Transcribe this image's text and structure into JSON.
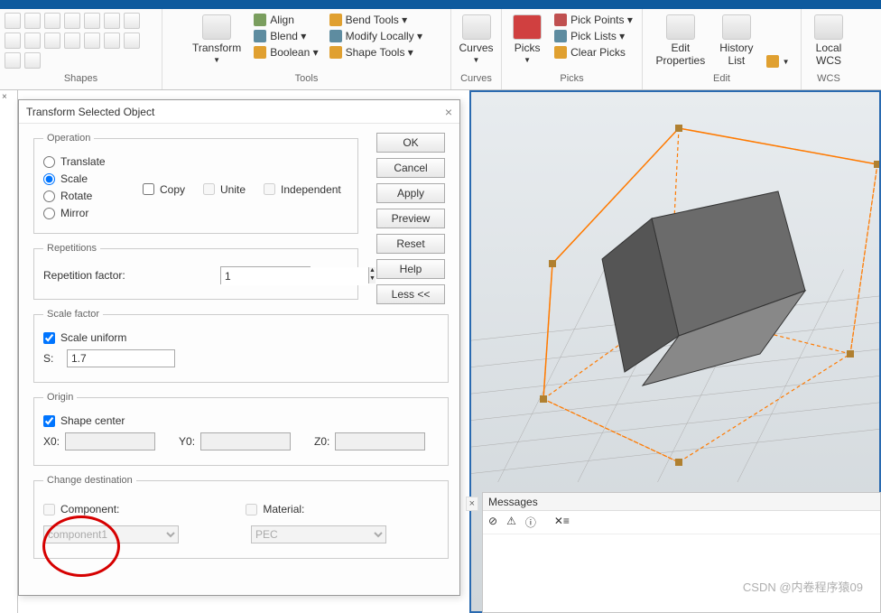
{
  "ribbon": {
    "groups": {
      "shapes": "Shapes",
      "tools": "Tools",
      "curves": "Curves",
      "picks": "Picks",
      "edit": "Edit",
      "wcs": "WCS"
    },
    "transform": "Transform",
    "align": "Align",
    "blend": "Blend ▾",
    "boolean": "Boolean ▾",
    "bend": "Bend Tools ▾",
    "modify": "Modify Locally ▾",
    "shapetools": "Shape Tools ▾",
    "curves_btn": "Curves",
    "picks_btn": "Picks",
    "pickpoints": "Pick Points ▾",
    "picklists": "Pick Lists ▾",
    "clearpicks": "Clear Picks",
    "editprops": "Edit\nProperties",
    "historylist": "History\nList",
    "localwcs": "Local\nWCS"
  },
  "dialog": {
    "title": "Transform Selected Object",
    "operation": {
      "legend": "Operation",
      "translate": "Translate",
      "scale": "Scale",
      "rotate": "Rotate",
      "mirror": "Mirror",
      "copy": "Copy",
      "unite": "Unite",
      "independent": "Independent"
    },
    "buttons": {
      "ok": "OK",
      "cancel": "Cancel",
      "apply": "Apply",
      "preview": "Preview",
      "reset": "Reset",
      "help": "Help",
      "less": "Less <<"
    },
    "repetitions": {
      "legend": "Repetitions",
      "factor_label": "Repetition factor:",
      "factor_value": "1"
    },
    "scalefactor": {
      "legend": "Scale factor",
      "uniform": "Scale uniform",
      "s_label": "S:",
      "s_value": "1.7"
    },
    "origin": {
      "legend": "Origin",
      "shape_center": "Shape center",
      "x0": "X0:",
      "y0": "Y0:",
      "z0": "Z0:"
    },
    "changedest": {
      "legend": "Change destination",
      "component": "Component:",
      "material": "Material:",
      "component_val": "component1",
      "material_val": "PEC"
    }
  },
  "messages": {
    "title": "Messages",
    "close": "×"
  },
  "watermark": "CSDN @内卷程序猿09"
}
